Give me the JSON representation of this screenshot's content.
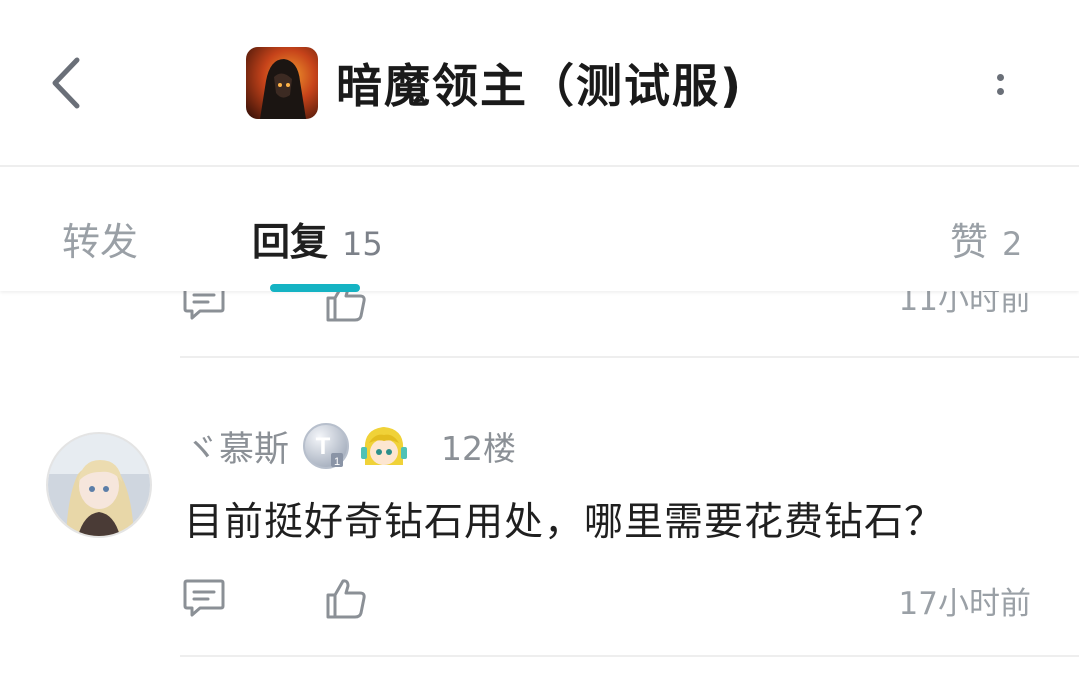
{
  "header": {
    "title": "暗魔领主（测试服)",
    "back_icon": "chevron-left-icon",
    "more_icon": "more-vertical-icon"
  },
  "tabs": [
    {
      "label": "转发",
      "count": ""
    },
    {
      "label": "回复",
      "count": "15"
    },
    {
      "label": "赞",
      "count": "2"
    }
  ],
  "accent_color": "#15b3c3",
  "comments": [
    {
      "timestamp": "11小时前"
    },
    {
      "username": "ヾ慕斯",
      "floor": "12楼",
      "text": "目前挺好奇钻石用处，哪里需要花费钻石？",
      "timestamp": "17小时前",
      "badges": [
        "level-badge-icon",
        "character-badge-icon"
      ]
    }
  ]
}
